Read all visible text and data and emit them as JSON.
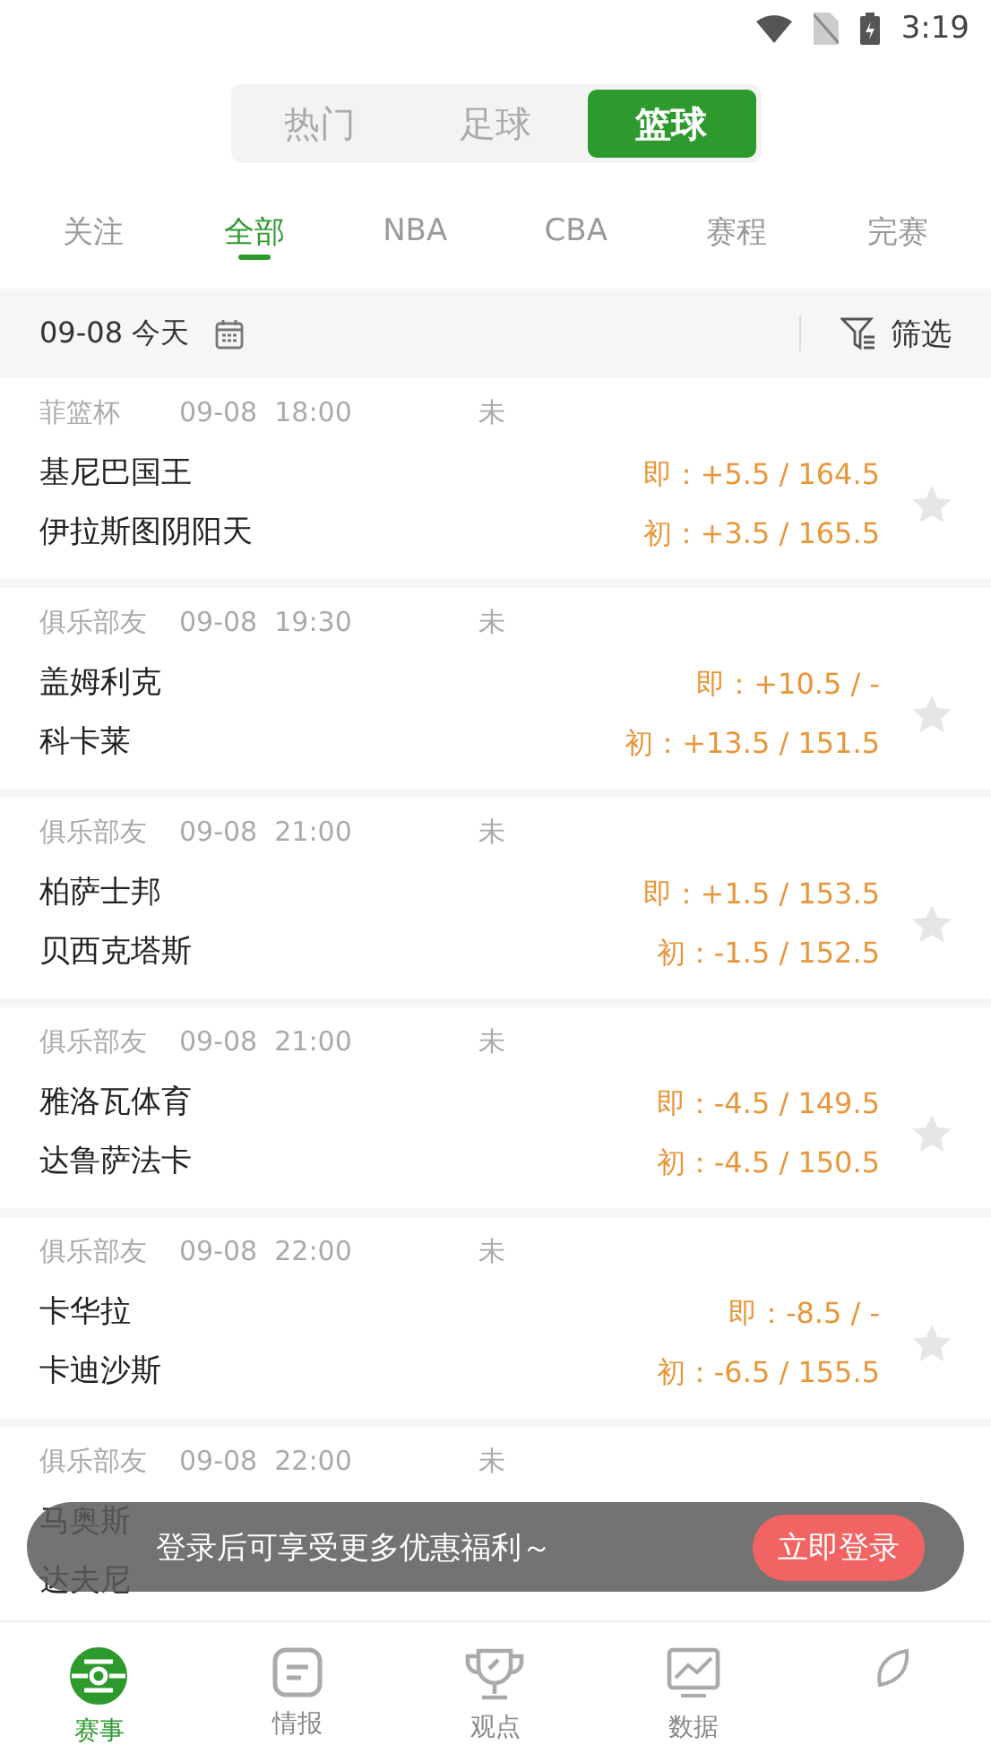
{
  "status_bar": {
    "time": "3:19"
  },
  "sport_tabs": [
    {
      "label": "热门",
      "selected": false
    },
    {
      "label": "足球",
      "selected": false
    },
    {
      "label": "篮球",
      "selected": true
    }
  ],
  "category_tabs": [
    {
      "label": "关注",
      "selected": false
    },
    {
      "label": "全部",
      "selected": true
    },
    {
      "label": "NBA",
      "selected": false
    },
    {
      "label": "CBA",
      "selected": false
    },
    {
      "label": "赛程",
      "selected": false
    },
    {
      "label": "完赛",
      "selected": false
    }
  ],
  "date_bar": {
    "date": "09-08 今天",
    "filter": "筛选"
  },
  "matches": [
    {
      "league": "菲篮杯",
      "date": "09-08",
      "time": "18:00",
      "status": "未",
      "home": "基尼巴国王",
      "away": "伊拉斯图阴阳天",
      "live_odds": "即：+5.5 / 164.5",
      "initial_odds": "初：+3.5 / 165.5",
      "starred": false
    },
    {
      "league": "俱乐部友",
      "date": "09-08",
      "time": "19:30",
      "status": "未",
      "home": "盖姆利克",
      "away": "科卡莱",
      "live_odds": "即：+10.5 / -",
      "initial_odds": "初：+13.5 / 151.5",
      "starred": false
    },
    {
      "league": "俱乐部友",
      "date": "09-08",
      "time": "21:00",
      "status": "未",
      "home": "柏萨士邦",
      "away": "贝西克塔斯",
      "live_odds": "即：+1.5 / 153.5",
      "initial_odds": "初：-1.5 / 152.5",
      "starred": false
    },
    {
      "league": "俱乐部友",
      "date": "09-08",
      "time": "21:00",
      "status": "未",
      "home": "雅洛瓦体育",
      "away": "达鲁萨法卡",
      "live_odds": "即：-4.5 / 149.5",
      "initial_odds": "初：-4.5 / 150.5",
      "starred": false
    },
    {
      "league": "俱乐部友",
      "date": "09-08",
      "time": "22:00",
      "status": "未",
      "home": "卡华拉",
      "away": "卡迪沙斯",
      "live_odds": "即：-8.5 / -",
      "initial_odds": "初：-6.5 / 155.5",
      "starred": false
    },
    {
      "league": "俱乐部友",
      "date": "09-08",
      "time": "22:00",
      "status": "未",
      "home": "马奥斯",
      "away": "达夫尼"
    }
  ],
  "toast": {
    "message": "登录后可享受更多优惠福利～",
    "button": "立即登录"
  },
  "bottom_nav": [
    {
      "label": "赛事",
      "kind": "ball",
      "selected": true
    },
    {
      "label": "情报",
      "kind": "note",
      "selected": false
    },
    {
      "label": "观点",
      "kind": "trophy",
      "selected": false
    },
    {
      "label": "数据",
      "kind": "chart",
      "selected": false
    },
    {
      "kind": "leaf",
      "selected": false
    }
  ]
}
